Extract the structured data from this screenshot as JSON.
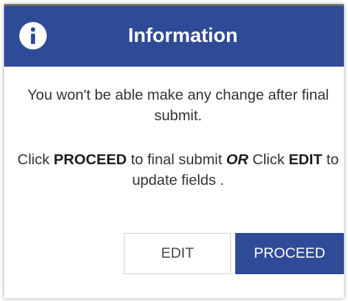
{
  "dialog": {
    "title": "Information",
    "icon": "info-icon",
    "accent_color": "#2f4a96",
    "message_line1": "You won't be able make any change after final submit.",
    "message_line2": {
      "part1": "Click ",
      "proceed_word": "PROCEED",
      "part2": " to final submit ",
      "or_word": "OR",
      "part3": " Click ",
      "edit_word": "EDIT",
      "part4": " to update fields ."
    },
    "buttons": {
      "edit_label": "EDIT",
      "proceed_label": "PROCEED"
    }
  }
}
